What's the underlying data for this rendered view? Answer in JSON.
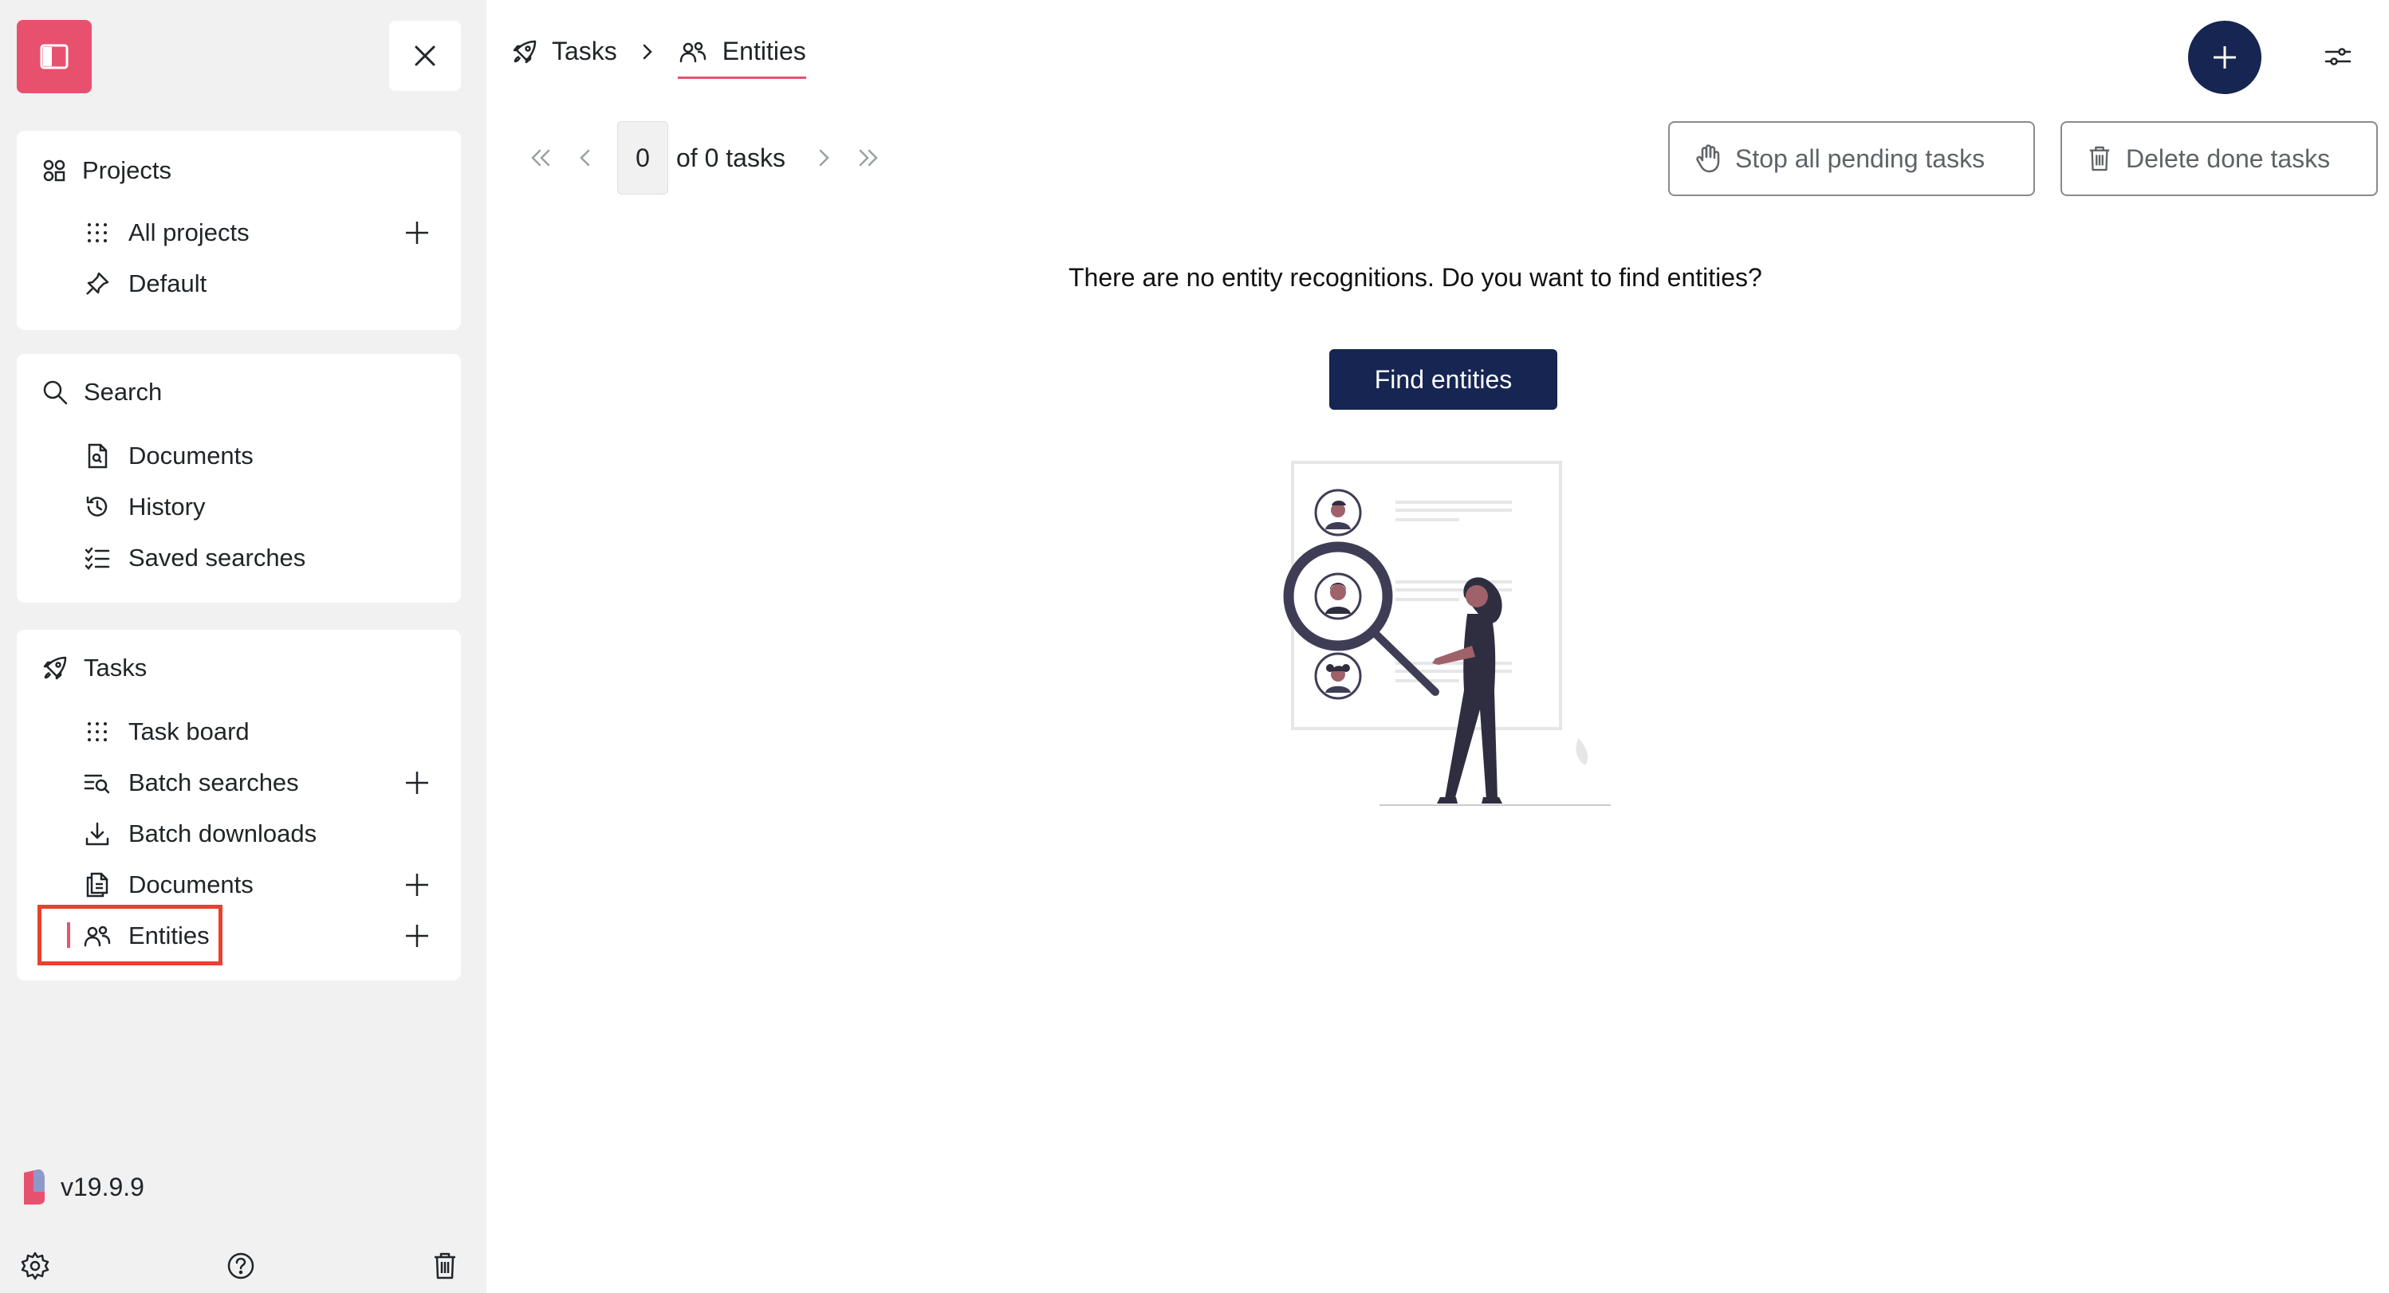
{
  "sidebar": {
    "projects": {
      "title": "Projects",
      "items": [
        {
          "label": "All projects",
          "icon": "grid-dots-icon"
        },
        {
          "label": "Default",
          "icon": "pin-icon"
        }
      ]
    },
    "search": {
      "title": "Search",
      "items": [
        {
          "label": "Documents",
          "icon": "file-search-icon"
        },
        {
          "label": "History",
          "icon": "history-icon"
        },
        {
          "label": "Saved searches",
          "icon": "checklist-icon"
        }
      ]
    },
    "tasks": {
      "title": "Tasks",
      "items": [
        {
          "label": "Task board",
          "icon": "grid-dots-icon"
        },
        {
          "label": "Batch searches",
          "icon": "list-search-icon"
        },
        {
          "label": "Batch downloads",
          "icon": "download-icon"
        },
        {
          "label": "Documents",
          "icon": "documents-icon"
        },
        {
          "label": "Entities",
          "icon": "users-icon",
          "active": true
        }
      ]
    },
    "version": "v19.9.9"
  },
  "breadcrumb": {
    "items": [
      {
        "label": "Tasks",
        "icon": "rocket-icon"
      },
      {
        "label": "Entities",
        "icon": "users-icon"
      }
    ]
  },
  "pagination": {
    "current_page": "0",
    "of_text": "of 0 tasks"
  },
  "actions": {
    "stop_all": "Stop all pending tasks",
    "delete_done": "Delete done tasks"
  },
  "empty_state": {
    "message": "There are no entity recognitions. Do you want to find entities?",
    "button": "Find entities"
  },
  "colors": {
    "brand_pink": "#e8516e",
    "navy": "#162552",
    "highlight_red": "#e8412e",
    "sidebar_bg": "#f1f1f1"
  }
}
